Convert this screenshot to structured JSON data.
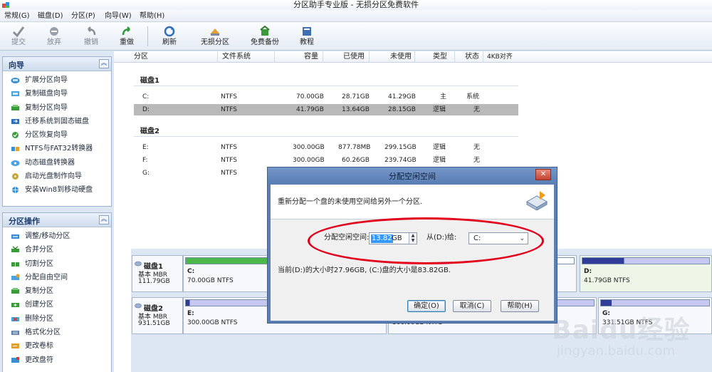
{
  "window": {
    "title": "分区助手专业版 - 无损分区免费软件"
  },
  "menu": [
    "常规(G)",
    "磁盘(D)",
    "分区(P)",
    "向导(W)",
    "帮助(H)"
  ],
  "toolbar": {
    "submit": "提交",
    "discard": "放弃",
    "undo": "撤销",
    "redo": "重做",
    "refresh": "刷新",
    "lossless": "无损分区",
    "backup": "免费备份",
    "tutorial": "教程"
  },
  "wizard": {
    "title": "向导",
    "items": [
      "扩展分区向导",
      "复制磁盘向导",
      "复制分区向导",
      "迁移系统到固态磁盘",
      "分区恢复向导",
      "NTFS与FAT32转换器",
      "动态磁盘转换器",
      "启动光盘制作向导",
      "安装Win8到移动硬盘"
    ]
  },
  "partition_ops": {
    "title": "分区操作",
    "items": [
      "调整/移动分区",
      "合并分区",
      "切割分区",
      "分配自由空间",
      "复制分区",
      "创建分区",
      "删除分区",
      "格式化分区",
      "更改卷标",
      "更改盘符"
    ]
  },
  "columns": [
    "分区",
    "文件系统",
    "容量",
    "已使用",
    "未使用",
    "类型",
    "状态",
    "4KB对齐"
  ],
  "disks": [
    {
      "label": "磁盘1",
      "rows": [
        {
          "part": "C:",
          "fs": "NTFS",
          "cap": "70.00GB",
          "used": "28.71GB",
          "free": "41.29GB",
          "type": "主",
          "status": "系统"
        },
        {
          "part": "D:",
          "fs": "NTFS",
          "cap": "41.79GB",
          "used": "13.64GB",
          "free": "28.15GB",
          "type": "逻辑",
          "status": "无"
        }
      ]
    },
    {
      "label": "磁盘2",
      "rows": [
        {
          "part": "E:",
          "fs": "NTFS",
          "cap": "300.00GB",
          "used": "877.78MB",
          "free": "299.15GB",
          "type": "逻辑",
          "status": "无"
        },
        {
          "part": "F:",
          "fs": "NTFS",
          "cap": "300.00GB",
          "used": "60.26GB",
          "free": "239.74GB",
          "type": "逻辑",
          "status": "无"
        },
        {
          "part": "G:",
          "fs": "NTFS"
        }
      ]
    }
  ],
  "map": {
    "disk1": {
      "name": "磁盘1",
      "type": "基本 MBR",
      "size": "111.79GB",
      "c_name": "C:",
      "c_info": "70.00GB NTFS",
      "d_name": "D:",
      "d_info": "41.79GB NTFS"
    },
    "disk2": {
      "name": "磁盘2",
      "type": "基本 MBR",
      "size": "931.51GB",
      "e_name": "E:",
      "e_info": "300.00GB NTFS",
      "f_info": "300.00GB NTFS",
      "g_name": "G:",
      "g_info": "331.51GB NTFS"
    }
  },
  "dialog": {
    "title": "分配空闲空间",
    "message": "重新分配一个盘的未使用空间给另外一个分区.",
    "amount_label": "分配空闲空间:",
    "amount_value": "13.82",
    "amount_unit": "GB",
    "from_label": "从(D:)给:",
    "target": "C:",
    "info": "当前(D:)的大小时27.96GB, (C:)盘的大小是83.82GB.",
    "ok": "确定(O)",
    "cancel": "取消(C)",
    "help": "帮助(H)",
    "close": "✕"
  },
  "watermark": {
    "brand": "Baidu经验",
    "site": "jingyan.baidu.com"
  },
  "colors": {
    "accent": "#5b7fb5",
    "highlight": "#e2001a",
    "used_bar": "#4cb84c",
    "free_bar": "#c6c8f2",
    "selected_row": "#b9b9b9"
  }
}
